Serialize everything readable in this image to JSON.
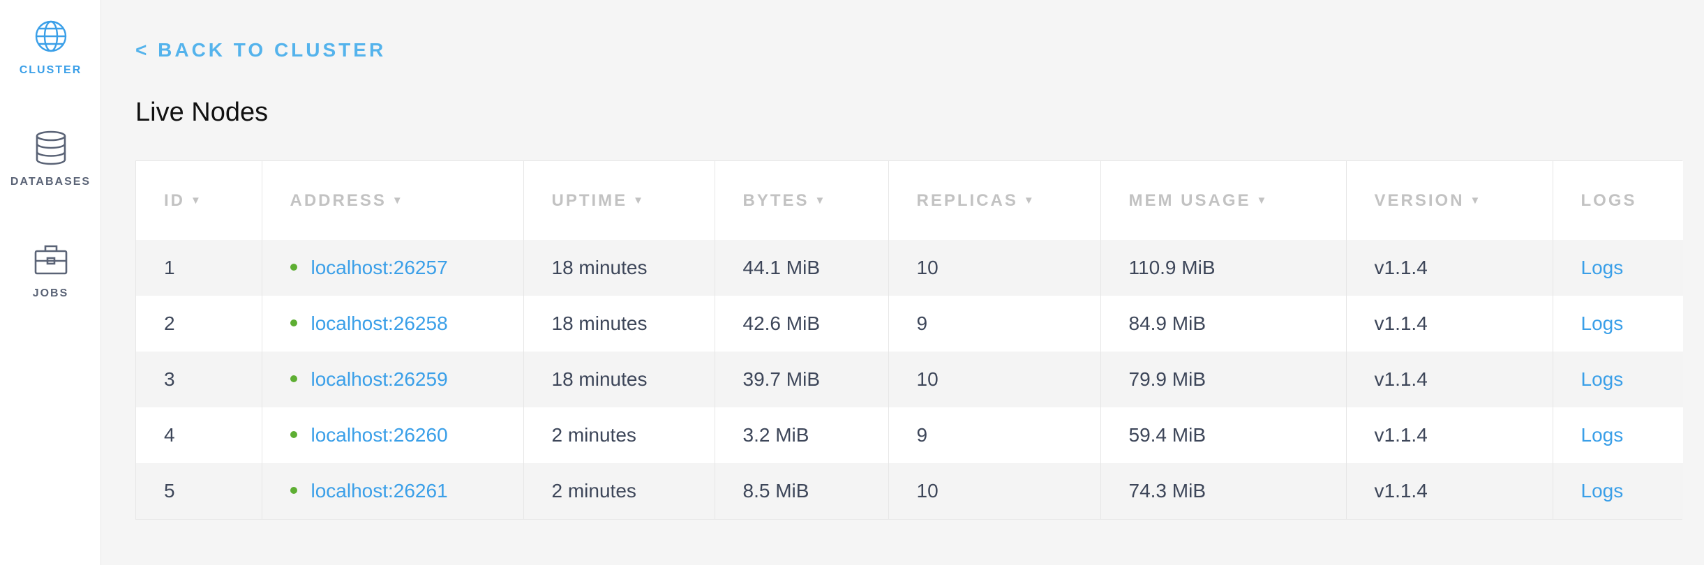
{
  "sidebar": {
    "items": [
      {
        "label": "CLUSTER",
        "icon": "globe-icon",
        "active": true
      },
      {
        "label": "DATABASES",
        "icon": "database-icon",
        "active": false
      },
      {
        "label": "JOBS",
        "icon": "briefcase-icon",
        "active": false
      }
    ]
  },
  "back_link": "< BACK TO CLUSTER",
  "page_title": "Live Nodes",
  "table": {
    "columns": [
      {
        "label": "ID",
        "sortable": true
      },
      {
        "label": "ADDRESS",
        "sortable": true
      },
      {
        "label": "UPTIME",
        "sortable": true
      },
      {
        "label": "BYTES",
        "sortable": true
      },
      {
        "label": "REPLICAS",
        "sortable": true
      },
      {
        "label": "MEM USAGE",
        "sortable": true
      },
      {
        "label": "VERSION",
        "sortable": true
      },
      {
        "label": "LOGS",
        "sortable": false
      }
    ],
    "sort_arrow": "▼",
    "rows": [
      {
        "id": "1",
        "address": "localhost:26257",
        "uptime": "18 minutes",
        "bytes": "44.1 MiB",
        "replicas": "10",
        "mem_usage": "110.9 MiB",
        "version": "v1.1.4",
        "logs": "Logs"
      },
      {
        "id": "2",
        "address": "localhost:26258",
        "uptime": "18 minutes",
        "bytes": "42.6 MiB",
        "replicas": "9",
        "mem_usage": "84.9 MiB",
        "version": "v1.1.4",
        "logs": "Logs"
      },
      {
        "id": "3",
        "address": "localhost:26259",
        "uptime": "18 minutes",
        "bytes": "39.7 MiB",
        "replicas": "10",
        "mem_usage": "79.9 MiB",
        "version": "v1.1.4",
        "logs": "Logs"
      },
      {
        "id": "4",
        "address": "localhost:26260",
        "uptime": "2 minutes",
        "bytes": "3.2 MiB",
        "replicas": "9",
        "mem_usage": "59.4 MiB",
        "version": "v1.1.4",
        "logs": "Logs"
      },
      {
        "id": "5",
        "address": "localhost:26261",
        "uptime": "2 minutes",
        "bytes": "8.5 MiB",
        "replicas": "10",
        "mem_usage": "74.3 MiB",
        "version": "v1.1.4",
        "logs": "Logs"
      }
    ]
  },
  "colors": {
    "accent": "#3a9fe8",
    "status_live": "#5dae32",
    "header_text": "#c2c2c2",
    "body_text": "#3d4659"
  }
}
